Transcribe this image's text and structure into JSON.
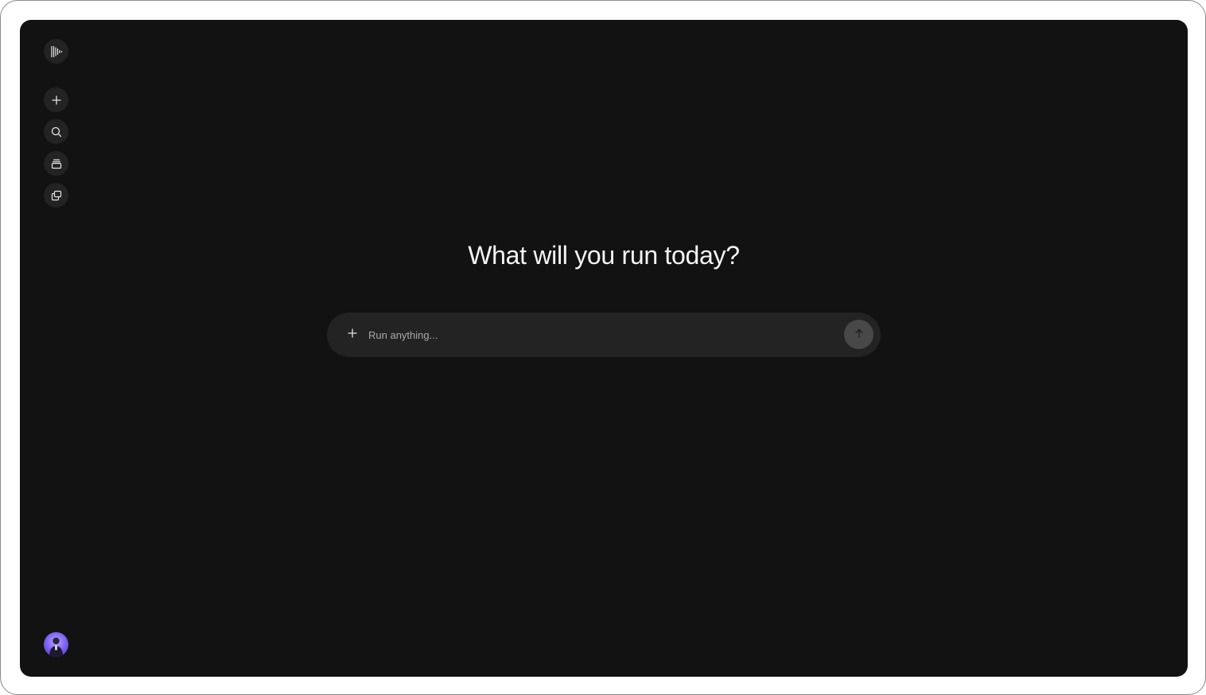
{
  "sidebar": {
    "logo_icon": "waveform-logo-icon",
    "items": [
      {
        "icon": "plus-icon",
        "name": "new-chat"
      },
      {
        "icon": "search-icon",
        "name": "search"
      },
      {
        "icon": "stack-icon",
        "name": "library"
      },
      {
        "icon": "copy-icon",
        "name": "projects"
      }
    ],
    "avatar_icon": "user-avatar"
  },
  "main": {
    "headline": "What will you run today?",
    "prompt": {
      "placeholder": "Run anything...",
      "value": "",
      "add_icon": "plus-icon",
      "send_icon": "arrow-up-icon"
    }
  },
  "colors": {
    "background": "#121212",
    "surface": "#232323",
    "send_button": "#484848",
    "text": "#f4f4f4"
  }
}
